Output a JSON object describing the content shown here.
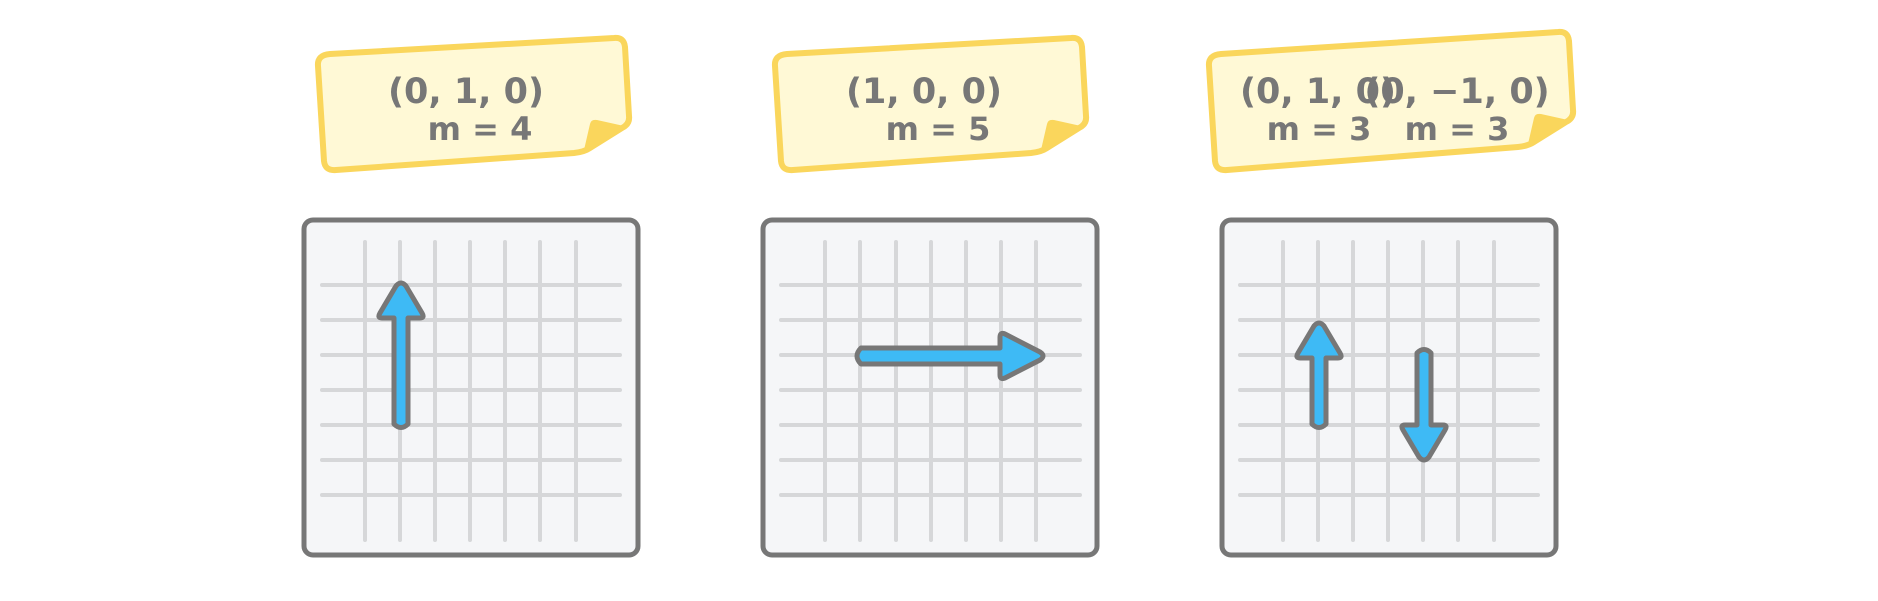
{
  "colors": {
    "note_fill": "#FFF9D6",
    "note_border": "#FAD65C",
    "note_fold": "#FAD65C",
    "grid_border": "#777777",
    "grid_fill": "#F5F6F8",
    "grid_line": "#D6D7D9",
    "arrow_fill": "#3EBAF5",
    "arrow_border": "#777777",
    "text": "#777777"
  },
  "panels": [
    {
      "labels": [
        {
          "vector": "(0, 1, 0)",
          "mass": "m = 4"
        }
      ],
      "arrows": [
        {
          "direction": "up"
        }
      ]
    },
    {
      "labels": [
        {
          "vector": "(1, 0, 0)",
          "mass": "m = 5"
        }
      ],
      "arrows": [
        {
          "direction": "right"
        }
      ]
    },
    {
      "labels": [
        {
          "vector": "(0, 1, 0)",
          "mass": "m = 3"
        },
        {
          "vector": "(0, −1, 0)",
          "mass": "m = 3"
        }
      ],
      "arrows": [
        {
          "direction": "up"
        },
        {
          "direction": "down"
        }
      ]
    }
  ]
}
